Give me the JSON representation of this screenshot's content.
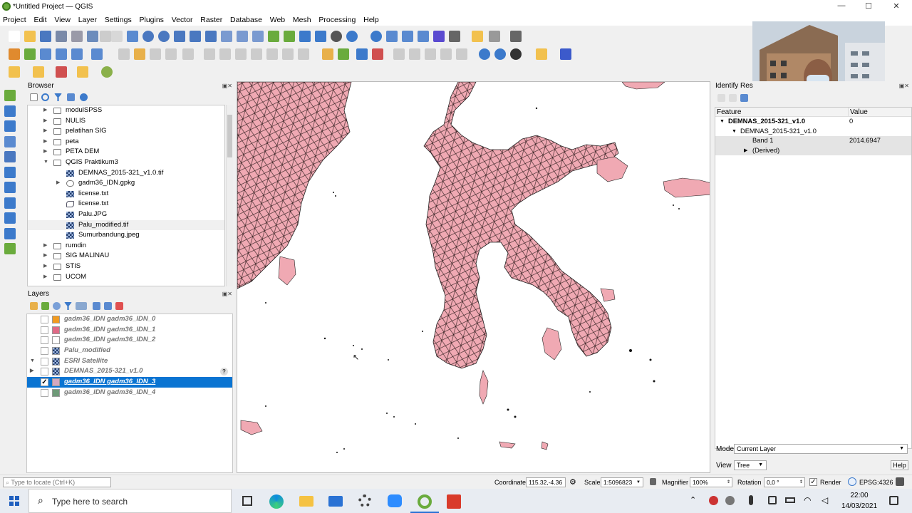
{
  "window": {
    "title": "*Untitled Project — QGIS",
    "controls": [
      "—",
      "☐",
      "✕"
    ]
  },
  "menu": [
    "Project",
    "Edit",
    "View",
    "Layer",
    "Settings",
    "Plugins",
    "Vector",
    "Raster",
    "Database",
    "Web",
    "Mesh",
    "Processing",
    "Help"
  ],
  "browser": {
    "title": "Browser",
    "items": [
      {
        "label": "modulSPSS",
        "type": "folder",
        "depth": 0,
        "arrow": "▶"
      },
      {
        "label": "NULIS",
        "type": "folder",
        "depth": 0,
        "arrow": "▶"
      },
      {
        "label": "pelatihan SIG",
        "type": "folder",
        "depth": 0,
        "arrow": "▶"
      },
      {
        "label": "peta",
        "type": "folder",
        "depth": 0,
        "arrow": "▶"
      },
      {
        "label": "PETA DEM",
        "type": "folder",
        "depth": 0,
        "arrow": "▶"
      },
      {
        "label": "QGIS Praktikum3",
        "type": "folder",
        "depth": 0,
        "arrow": "▼"
      },
      {
        "label": "DEMNAS_2015-321_v1.0.tif",
        "type": "raster",
        "depth": 1,
        "arrow": ""
      },
      {
        "label": "gadm36_IDN.gpkg",
        "type": "db",
        "depth": 1,
        "arrow": "▶"
      },
      {
        "label": "license.txt",
        "type": "raster",
        "depth": 1,
        "arrow": ""
      },
      {
        "label": "license.txt",
        "type": "vector",
        "depth": 1,
        "arrow": ""
      },
      {
        "label": "Palu.JPG",
        "type": "raster",
        "depth": 1,
        "arrow": ""
      },
      {
        "label": "Palu_modified.tif",
        "type": "raster",
        "depth": 1,
        "arrow": "",
        "highlight": true
      },
      {
        "label": "Sumurbandung.jpeg",
        "type": "raster",
        "depth": 1,
        "arrow": ""
      },
      {
        "label": "rumdin",
        "type": "folder",
        "depth": 0,
        "arrow": "▶"
      },
      {
        "label": "SIG MALINAU",
        "type": "folder",
        "depth": 0,
        "arrow": "▶"
      },
      {
        "label": "STIS",
        "type": "folder",
        "depth": 0,
        "arrow": "▶"
      },
      {
        "label": "UCOM",
        "type": "folder",
        "depth": 0,
        "arrow": "▶"
      }
    ]
  },
  "layers": {
    "title": "Layers",
    "items": [
      {
        "name": "gadm36_IDN gadm36_IDN_0",
        "swatch": "#f29b1f",
        "checked": false,
        "selected": false,
        "arrow": ""
      },
      {
        "name": "gadm36_IDN gadm36_IDN_1",
        "swatch": "#e06a86",
        "checked": false,
        "selected": false,
        "arrow": ""
      },
      {
        "name": "gadm36_IDN gadm36_IDN_2",
        "swatch": "#ffffff",
        "checked": false,
        "selected": false,
        "arrow": ""
      },
      {
        "name": "Palu_modified",
        "swatch": "raster",
        "checked": false,
        "selected": false,
        "arrow": ""
      },
      {
        "name": "ESRI Satellite",
        "swatch": "raster",
        "checked": false,
        "selected": false,
        "arrow": "▼"
      },
      {
        "name": "DEMNAS_2015-321_v1.0",
        "swatch": "raster",
        "checked": false,
        "selected": false,
        "arrow": "▶",
        "badge": "?"
      },
      {
        "name": "gadm36_IDN gadm36_IDN_3",
        "swatch": "#d5a8c0",
        "checked": true,
        "selected": true,
        "arrow": ""
      },
      {
        "name": "gadm36_IDN gadm36_IDN_4",
        "swatch": "#6e9a78",
        "checked": false,
        "selected": false,
        "arrow": ""
      }
    ]
  },
  "identify": {
    "title": "Identify Res",
    "columns": [
      "Feature",
      "Value"
    ],
    "rows": [
      {
        "feature": "DEMNAS_2015-321_v1.0",
        "value": "0",
        "depth": 0,
        "arrow": "▼",
        "bold": true
      },
      {
        "feature": "DEMNAS_2015-321_v1.0",
        "value": "",
        "depth": 1,
        "arrow": "▼",
        "bold": false
      },
      {
        "feature": "Band 1",
        "value": "2014.6947",
        "depth": 2,
        "arrow": "",
        "bold": false,
        "highlight": true
      },
      {
        "feature": "(Derived)",
        "value": "",
        "depth": 2,
        "arrow": "▶",
        "bold": false,
        "highlight": true
      }
    ],
    "mode_label": "Mode",
    "mode_value": "Current Layer",
    "view_label": "View",
    "view_value": "Tree",
    "help_label": "Help"
  },
  "statusbar": {
    "locate_placeholder": "Type to locate (Ctrl+K)",
    "coordinate_label": "Coordinate",
    "coordinate_value": "115.32,-4.36",
    "scale_label": "Scale",
    "scale_value": "1:5096823",
    "magnifier_label": "Magnifier",
    "magnifier_value": "100%",
    "rotation_label": "Rotation",
    "rotation_value": "0,0 °",
    "render_label": "Render",
    "crs": "EPSG:4326"
  },
  "taskbar": {
    "search_placeholder": "Type here to search",
    "time": "22:00",
    "date": "14/03/2021"
  },
  "colors": {
    "polygon_fill": "#f0a9b3",
    "selection": "#0a74d2"
  }
}
